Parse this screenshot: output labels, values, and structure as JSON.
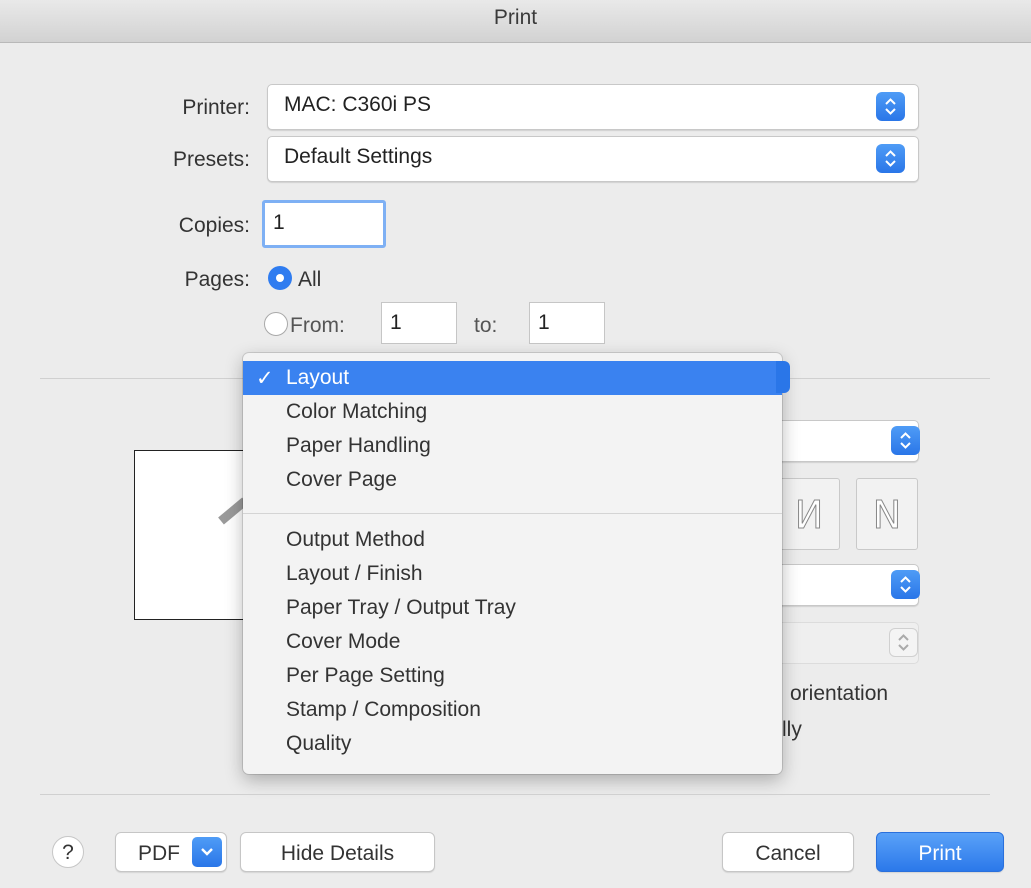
{
  "window": {
    "title": "Print"
  },
  "printer": {
    "label": "Printer:",
    "value": "MAC: C360i PS"
  },
  "presets": {
    "label": "Presets:",
    "value": "Default Settings"
  },
  "copies": {
    "label": "Copies:",
    "value": "1"
  },
  "pages": {
    "label": "Pages:",
    "all_label": "All",
    "from_label": "From:",
    "from_value": "1",
    "to_label": "to:",
    "to_value": "1",
    "selected": "All"
  },
  "panel_menu": {
    "selected": "Layout",
    "group1": [
      "Layout",
      "Color Matching",
      "Paper Handling",
      "Cover Page"
    ],
    "group2": [
      "Output Method",
      "Layout / Finish",
      "Paper Tray / Output Tray",
      "Cover Mode",
      "Per Page Setting",
      "Stamp / Composition",
      "Quality"
    ]
  },
  "background_options": {
    "orientation_text": "orientation",
    "partial_text": "lly"
  },
  "orientation_icons": {
    "first": "N-mirrored-icon",
    "second": "N-icon"
  },
  "footer": {
    "help": "?",
    "pdf": "PDF",
    "hide_details": "Hide Details",
    "cancel": "Cancel",
    "print": "Print"
  },
  "colors": {
    "accent": "#2f7cf0",
    "menu_highlight": "#3a82f0"
  }
}
